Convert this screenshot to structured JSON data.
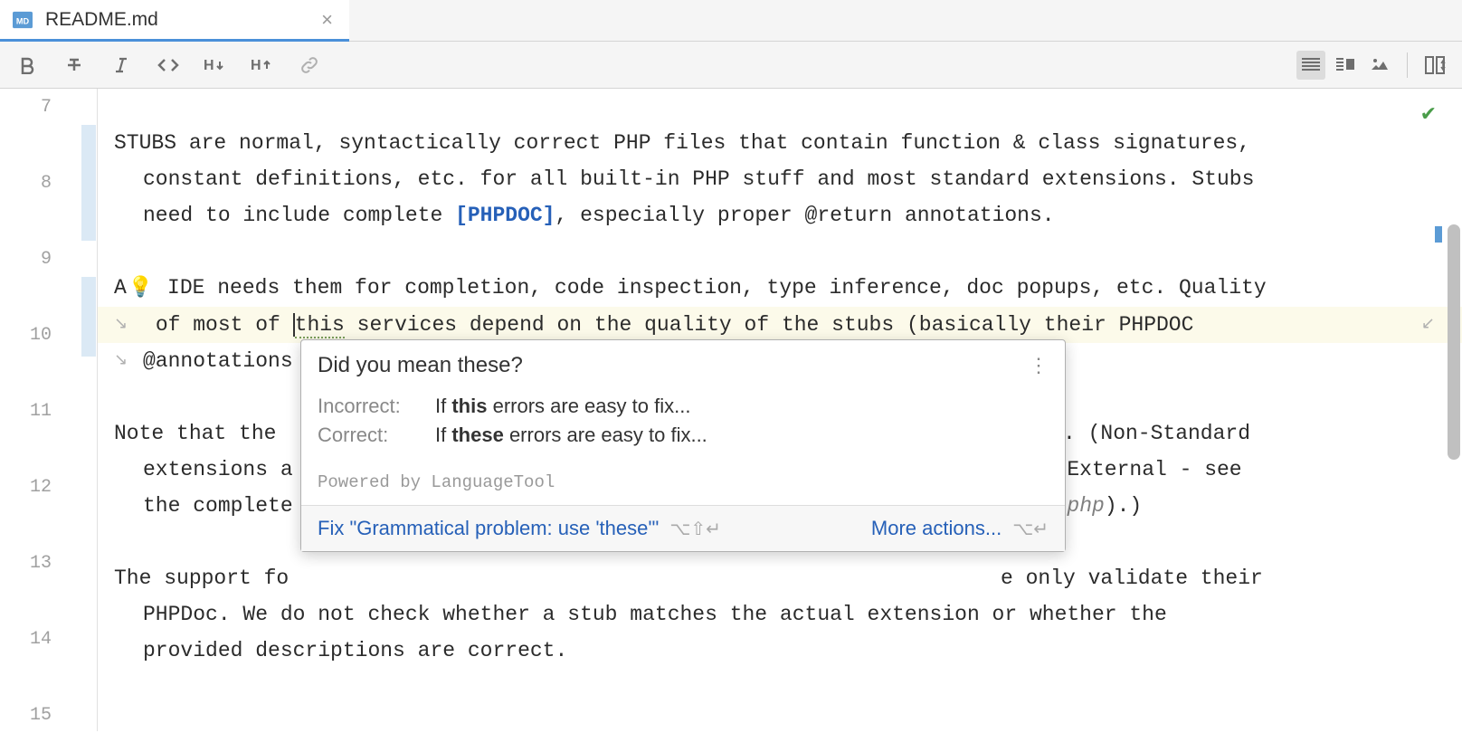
{
  "tab": {
    "filename": "README.md",
    "icon": "MD"
  },
  "gutter": {
    "lines": [
      "7",
      "8",
      "9",
      "10",
      "11",
      "12",
      "13",
      "14",
      "15"
    ]
  },
  "code": {
    "line8_a": "STUBS are normal, syntactically correct PHP files that contain function & class signatures, ",
    "line8_b": "constant definitions, etc. for all built-in PHP stuff and most standard extensions. Stubs ",
    "line8_c": "need to include complete ",
    "line8_link": "[PHPDOC]",
    "line8_d": ", especially proper @return annotations.",
    "line10_a": "A",
    "line10_b": " IDE needs them for completion, code inspection, type inference, doc popups, etc. Quality",
    "line10_c": " of most of ",
    "line10_err": "this",
    "line10_d": " services depend on the quality of the stubs (basically their PHPDOC ",
    "line10_e": "@annotations",
    "line12_a": "Note that the ",
    "line12_b": ". (Non-Standard ",
    "line12_c": "extensions a",
    "line12_d": "undled/External - see ",
    "line12_e": "the complete",
    "line12_f": "rship.php",
    "line12_g": ").)",
    "line14_a": "The support fo",
    "line14_b": "e only validate their ",
    "line14_c": "PHPDoc. We do not check whether a stub matches the actual extension or whether the ",
    "line14_d": "provided descriptions are correct."
  },
  "popup": {
    "title": "Did you mean these?",
    "incorrect_label": "Incorrect:",
    "incorrect_prefix": "If ",
    "incorrect_bold": "this",
    "incorrect_suffix": " errors are easy to fix...",
    "correct_label": "Correct:",
    "correct_prefix": "If ",
    "correct_bold": "these",
    "correct_suffix": " errors are easy to fix...",
    "powered": "Powered by LanguageTool",
    "fix_label": "Fix \"Grammatical problem: use 'these'\"",
    "fix_shortcut": "⌥⇧↵",
    "more_label": "More actions...",
    "more_shortcut": "⌥↵"
  }
}
